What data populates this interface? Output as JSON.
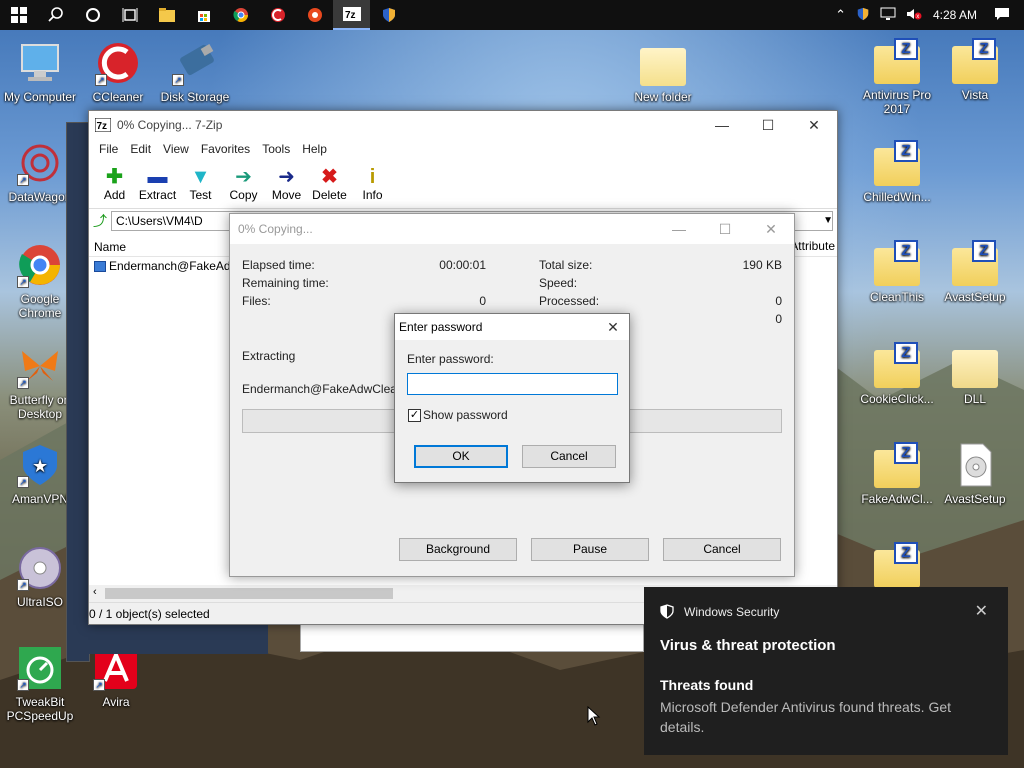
{
  "taskbar": {
    "clock": "4:28 AM",
    "apps": [
      "start",
      "search",
      "cortana",
      "task-view",
      "file-explorer",
      "store",
      "chrome",
      "ccleaner",
      "avast",
      "7zip",
      "defender"
    ]
  },
  "desktop_icons": {
    "my_computer": "My Computer",
    "ccleaner": "CCleaner",
    "disk_storage": "Disk Storage",
    "datawagon": "DataWagon",
    "chrome": "Google Chrome",
    "butterfly": "Butterfly on Desktop",
    "amanvpn": "AmanVPN",
    "ultraiso": "UltraISO",
    "tweakbit": "TweakBit PCSpeedUp",
    "avira": "Avira",
    "new_folder": "New folder",
    "antivirus_pro": "Antivirus Pro 2017",
    "vista": "Vista",
    "chilledwin": "ChilledWin...",
    "cleanthis": "CleanThis",
    "avastsetup_folder": "AvastSetup",
    "cookieclick": "CookieClick...",
    "dll": "DLL",
    "fakeadwcl": "FakeAdwCl...",
    "avastsetup_file": "AvastSetup"
  },
  "main_window": {
    "title": "0% Copying... 7-Zip",
    "menu": [
      "File",
      "Edit",
      "View",
      "Favorites",
      "Tools",
      "Help"
    ],
    "toolbar": [
      "Add",
      "Extract",
      "Test",
      "Copy",
      "Move",
      "Delete",
      "Info"
    ],
    "address": "C:\\Users\\VM4\\D",
    "col_name": "Name",
    "col_attr": "Attribute",
    "file": "Endermanch@FakeAdw",
    "status": "0 / 1 object(s) selected"
  },
  "copy_dialog": {
    "title": "0% Copying...",
    "elapsed_label": "Elapsed time:",
    "elapsed_value": "00:00:01",
    "remaining_label": "Remaining time:",
    "files_label": "Files:",
    "files_value": "0",
    "total_size_label": "Total size:",
    "total_size_value": "190 KB",
    "speed_label": "Speed:",
    "processed_label": "Processed:",
    "processed_value": "0",
    "extra_value": "0",
    "operation": "Extracting",
    "current_file": "Endermanch@FakeAdwCleaner",
    "progress": 0,
    "background_btn": "Background",
    "pause_btn": "Pause",
    "cancel_btn": "Cancel"
  },
  "password_dialog": {
    "title": "Enter password",
    "label": "Enter password:",
    "value": "",
    "show_password_label": "Show password",
    "show_password_checked": true,
    "ok_btn": "OK",
    "cancel_btn": "Cancel"
  },
  "notification": {
    "source": "Windows Security",
    "heading": "Virus & threat protection",
    "subheading": "Threats found",
    "body": "Microsoft Defender Antivirus found threats. Get details."
  },
  "colors": {
    "taskbar": "#101010",
    "toast": "#1f1f1f",
    "focus_border": "#0078d7"
  }
}
